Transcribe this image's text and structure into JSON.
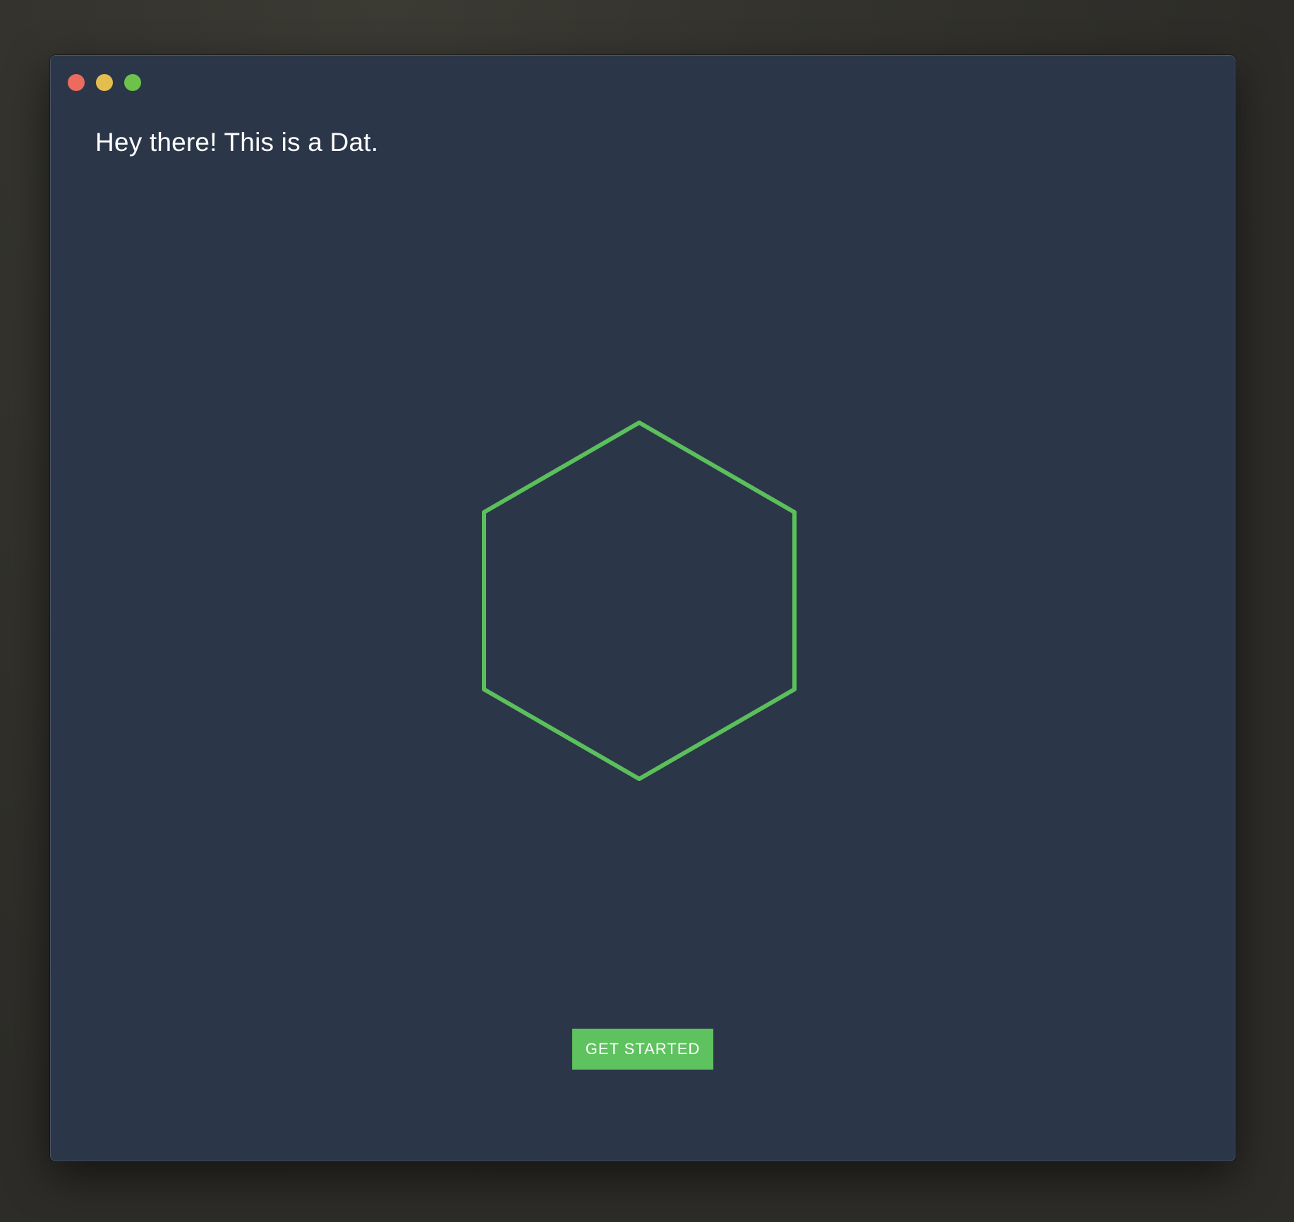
{
  "window": {
    "controls": [
      {
        "name": "close",
        "color": "#ec6a5e"
      },
      {
        "name": "minimize",
        "color": "#e4bd4f"
      },
      {
        "name": "maximize",
        "color": "#6cc24a"
      }
    ]
  },
  "main": {
    "greeting": "Hey there! This is a Dat.",
    "logo_icon": "hexagon-outline-icon",
    "get_started_label": "GET STARTED"
  },
  "colors": {
    "window_background": "#2b3649",
    "accent_green": "#5bbf5b",
    "button_green": "#5ec35e",
    "text": "#ffffff"
  }
}
